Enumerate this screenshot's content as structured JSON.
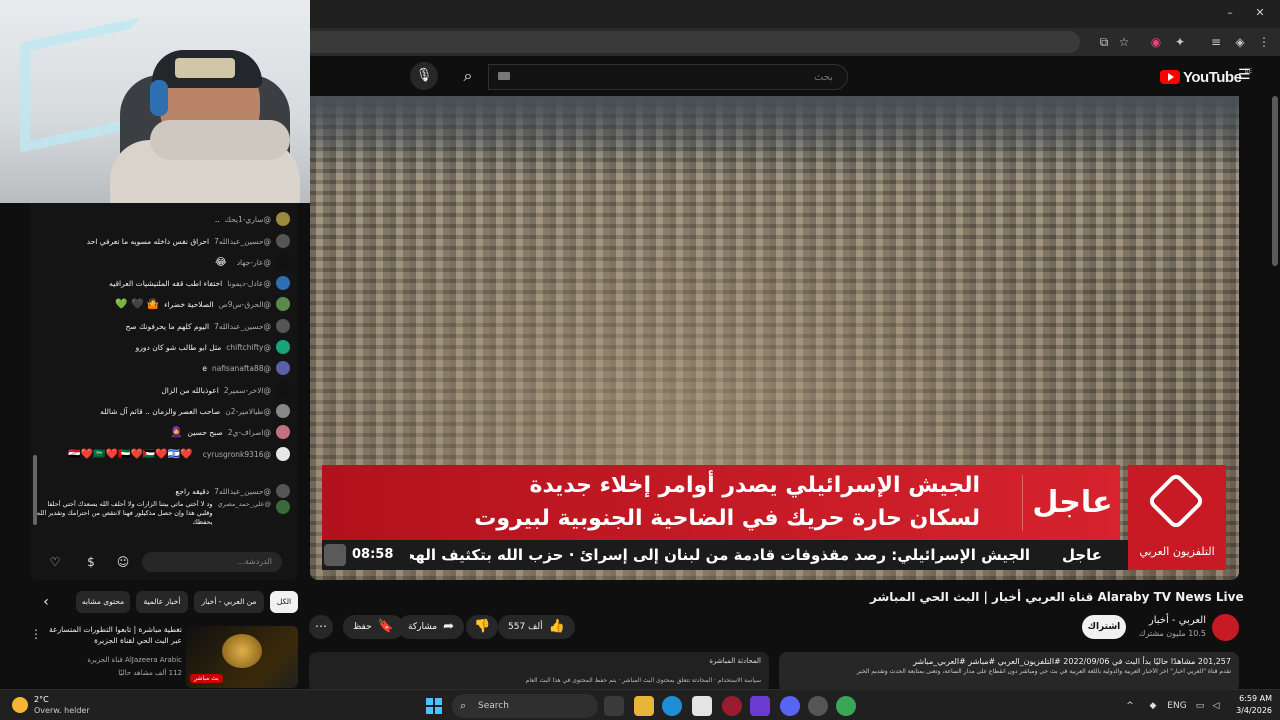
{
  "browser": {
    "window_controls": [
      "–",
      "◻",
      "✕"
    ]
  },
  "youtube": {
    "search_placeholder": "بحث",
    "logo_text": "YouTube",
    "logo_country": "BE"
  },
  "video": {
    "urgent_label": "عاجل",
    "headline_line1": "الجيش الإسرائيلي يصدر أوامر إخلاء جديدة",
    "headline_line2": "لسكان حارة حريك في الضاحية الجنوبية لبيروت",
    "channel_logo_text": "التلفزيون العربي",
    "ticker_label": "عاجل",
    "ticker_text": "الجيش الإسرائيلي: رصد مقذوفات قادمة من لبنان إلى إسرائ · حزب الله بتكثيف الهجمات",
    "ticker_time": "08:58",
    "title": "قناة العربي أخبار | البث الحي المباشر Alaraby TV News Live",
    "channel_name": "العربي - أخبار",
    "channel_subs": "10.5 مليون مشترك",
    "subscribe_label": "اشتراك",
    "likes": "557 ألف",
    "share_label": "مشاركة",
    "save_label": "حفظ",
    "more_label": "⋯",
    "desc_meta": "201,257 مشاهدًا حاليًا  بدأ البث في 2022/09/06  #التلفزيون_العربي #مباشر #العربي_مباشر",
    "desc_line": "تقدم قناة \"العربي أخبار\" آخر الأخبار العربية والدولية باللغة العربية في بث حي ومباشر دون انقطاع على مدار الساعة، وتعنى بمتابعة الحدث وتقديم الخبر",
    "livechat_title": "المحادثة المباشرة",
    "livechat_line": "سياسة الاستخدام · المحادثة تتعلق بمحتوى البث المباشر · يتم حفظ المحتوى في هذا البث العام"
  },
  "chat": {
    "messages": [
      {
        "author": "@ساري-1يحك",
        "text": "..",
        "emoji": "",
        "color": "#9a8a3a"
      },
      {
        "author": "@حسين_عبدالله7",
        "text": "احراق نفس داخله مسويه ما تعرفي احد",
        "emoji": "",
        "color": "#555"
      },
      {
        "author": "@عار-جهاد",
        "text": "",
        "emoji": "😂",
        "color": "#111"
      },
      {
        "author": "@عادل-ديمونا",
        "text": "اختفاء اطب ققه الملتيشيات العراقيه",
        "emoji": "",
        "color": "#2b6fb0"
      },
      {
        "author": "@الحرق-س9ص",
        "text": "الصلاحية خضراء",
        "emoji": "🤷 🖤 💚",
        "color": "#5a8a4a"
      },
      {
        "author": "@حسين_عبدالله7",
        "text": "اليوم كلهم ما يحرفونك صح",
        "emoji": "",
        "color": "#555"
      },
      {
        "author": "@chiftchifty",
        "text": "مثل ابو طالب شو كان دورو",
        "emoji": "",
        "color": "#1aa37a"
      },
      {
        "author": "@nafisanafta88",
        "text": "e",
        "emoji": "",
        "color": "#5b5ea8"
      },
      {
        "author": "@الاخر-سمير2",
        "text": "اعوذبالله من الزال",
        "emoji": "",
        "color": "#111"
      },
      {
        "author": "@طيالامير-2ن",
        "text": "صاحب العصر والزمان .. قائم آل شالله",
        "emoji": "",
        "color": "#888"
      },
      {
        "author": "@اصراف-ي2",
        "text": "صبح حسين",
        "emoji": "🧕",
        "color": "#c07080"
      },
      {
        "author": "@cyrusgronk9316",
        "text": "",
        "emoji": "❤️🇮🇶❤️🇸🇦❤️🇦🇪❤️🇵🇸❤️🇮🇱",
        "color": "#e6e6e6"
      },
      {
        "author": "@حسين_عبدالله7",
        "text": "دقيقه راجع",
        "emoji": "",
        "color": "#555"
      },
      {
        "author": "@علي_حمد_مصري",
        "text": "ود لا أختي ماتي بيتنا الزارات ولا أحلف الله يسعدك أختي أحلفا وقلبي هذا وإن حصل مذكيلور فهنا لانتقص من احترامك وتقدير الله يحفظك",
        "emoji": "",
        "color": "#3a6a3a"
      }
    ],
    "input_placeholder": "الدردشة..."
  },
  "chips": [
    "الكل",
    "من العربي - أخبار",
    "أخبار عالمية",
    "محتوى مشابه"
  ],
  "recommendation": {
    "title": "تغطية مباشرة | تابعوا التطورات المتسارعة عبر البث الحي لقناة الجزيرة",
    "channel": "AlJazeera Arabic قناة الجزيرة",
    "views": "112 ألف مشاهد حاليًا",
    "live_badge": "بث مباشر"
  },
  "taskbar": {
    "temperature": "2°C",
    "weather_desc": "Overw. helder",
    "search_label": "Search",
    "lang": "ENG",
    "time": "6:59 AM",
    "date": "3/4/2026"
  },
  "colors": {
    "accent_red": "#d6232e",
    "youtube_red": "#ff0000",
    "windows_blue": "#4cc2ff"
  }
}
